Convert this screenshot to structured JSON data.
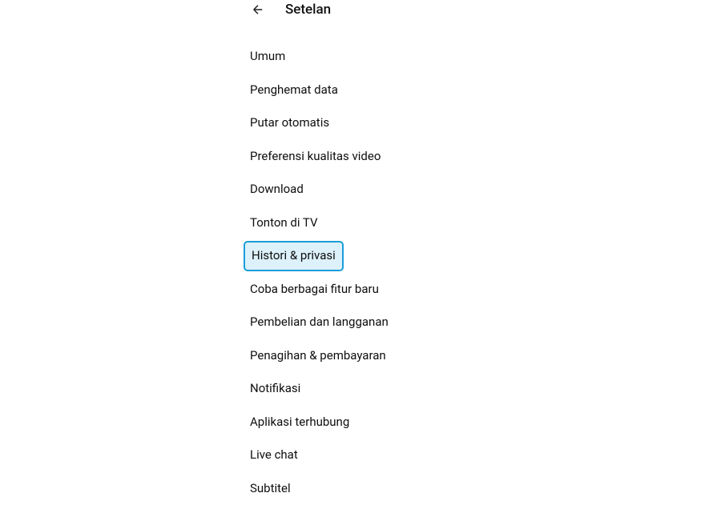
{
  "header": {
    "title": "Setelan"
  },
  "menu": {
    "items": [
      {
        "label": "Umum",
        "highlighted": false
      },
      {
        "label": "Penghemat data",
        "highlighted": false
      },
      {
        "label": "Putar otomatis",
        "highlighted": false
      },
      {
        "label": "Preferensi kualitas video",
        "highlighted": false
      },
      {
        "label": "Download",
        "highlighted": false
      },
      {
        "label": "Tonton di TV",
        "highlighted": false
      },
      {
        "label": "Histori & privasi",
        "highlighted": true
      },
      {
        "label": "Coba berbagai fitur baru",
        "highlighted": false
      },
      {
        "label": "Pembelian dan langganan",
        "highlighted": false
      },
      {
        "label": "Penagihan & pembayaran",
        "highlighted": false
      },
      {
        "label": "Notifikasi",
        "highlighted": false
      },
      {
        "label": "Aplikasi terhubung",
        "highlighted": false
      },
      {
        "label": "Live chat",
        "highlighted": false
      },
      {
        "label": "Subtitel",
        "highlighted": false
      }
    ]
  }
}
